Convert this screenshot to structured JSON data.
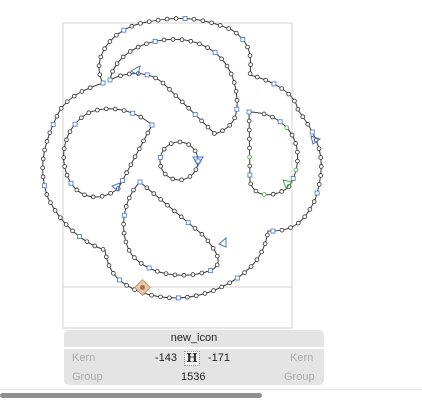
{
  "glyph": {
    "name": "new_icon",
    "glyph_char": "H",
    "unicode": ""
  },
  "metrics": {
    "kern_left_label": "Kern",
    "kern_left_value": "-143",
    "kern_right_value": "-171",
    "kern_right_label": "Kern",
    "group_left_label": "Group",
    "width_value": "1536",
    "group_right_label": "Group"
  },
  "colors": {
    "outline": "#3a3a3a",
    "node_fill": "#ffffff",
    "node_blue": "#4a72c4",
    "node_green": "#4aa04a",
    "anchor": "#d8a883"
  }
}
